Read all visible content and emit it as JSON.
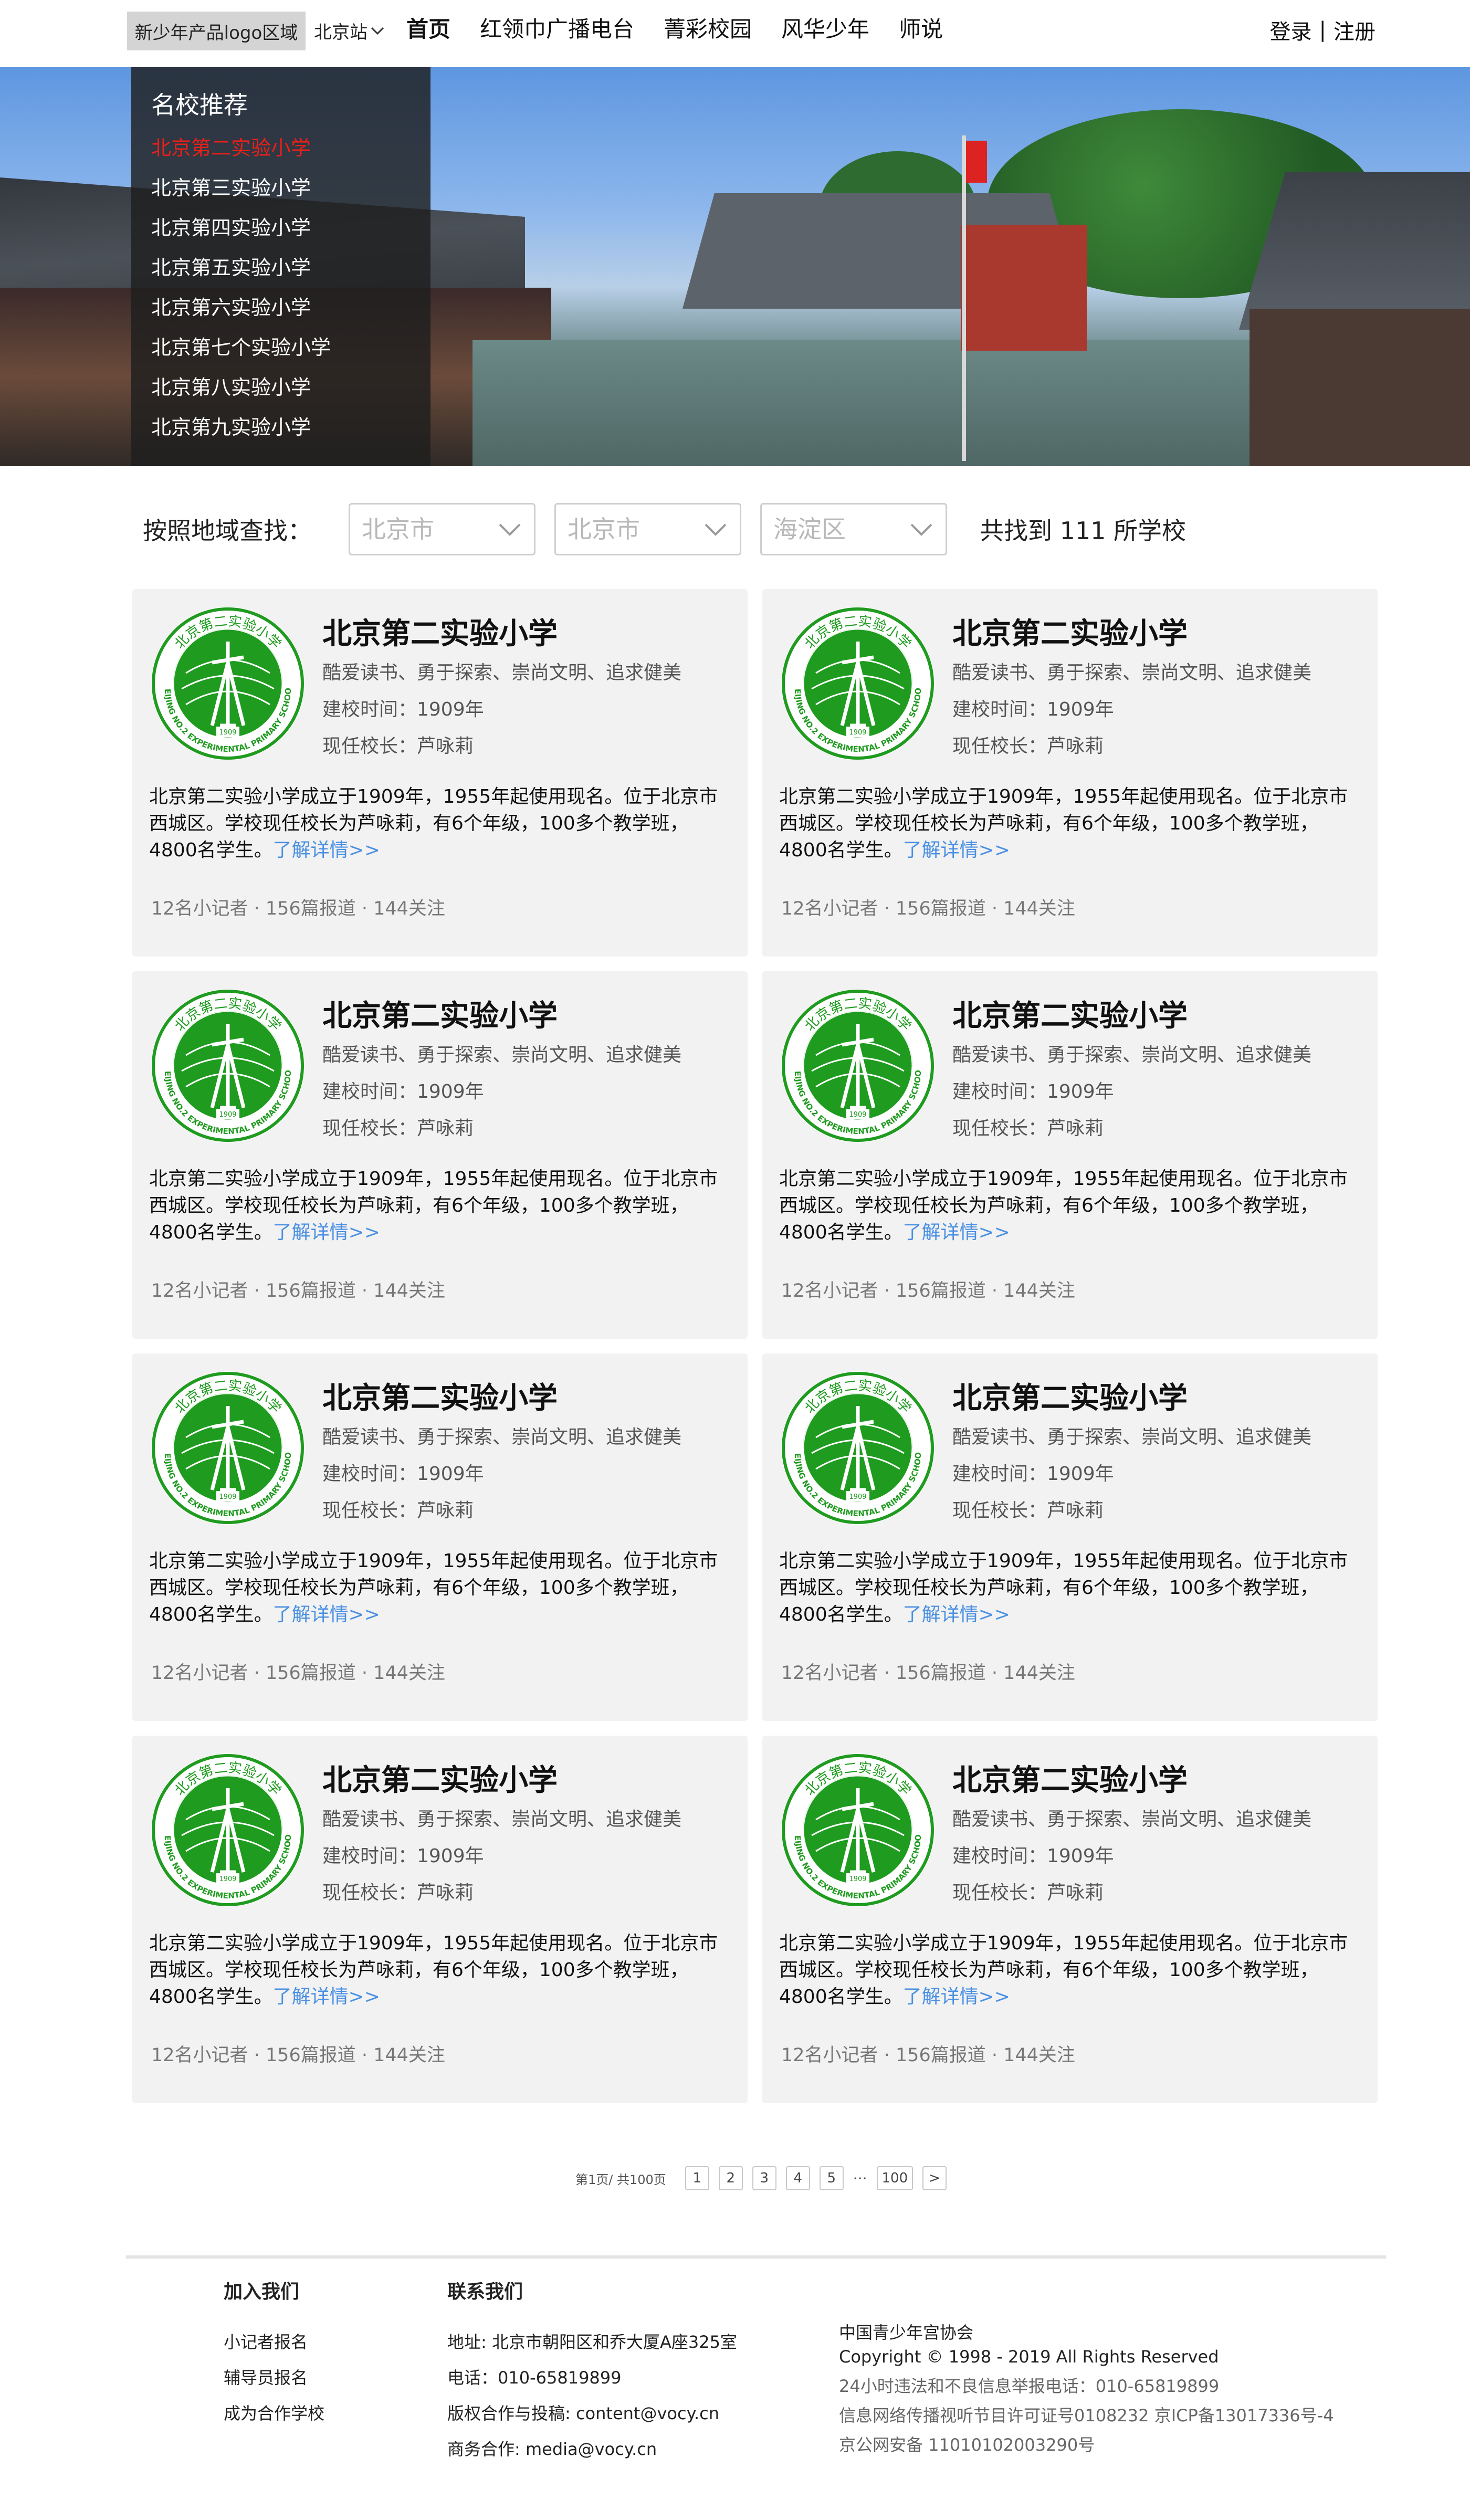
{
  "header": {
    "logo_text": "新少年产品logo区域",
    "station": "北京站",
    "nav": [
      "首页",
      "红领巾广播电台",
      "菁彩校园",
      "风华少年",
      "师说"
    ],
    "login": "登录",
    "separator": "|",
    "register": "注册"
  },
  "hero": {
    "panel_title": "名校推荐",
    "schools": [
      "北京第二实验小学",
      "北京第三实验小学",
      "北京第四实验小学",
      "北京第五实验小学",
      "北京第六实验小学",
      "北京第七个实验小学",
      "北京第八实验小学",
      "北京第九实验小学"
    ]
  },
  "filter": {
    "label": "按照地域查找：",
    "selects": [
      "北京市",
      "北京市",
      "海淀区"
    ],
    "result": "共找到 111 所学校"
  },
  "cards": [
    {
      "title": "北京第二实验小学",
      "motto": "酷爱读书、勇于探索、崇尚文明、追求健美",
      "founded": "建校时间：1909年",
      "principal": "现任校长：芦咏莉",
      "desc": "北京第二实验小学成立于1909年，1955年起使用现名。位于北京市西城区。学校现任校长为芦咏莉，有6个年级，100多个教学班，4800名学生。",
      "more": "了解详情>>",
      "stats": "12名小记者 · 156篇报道 · 144关注"
    },
    {
      "title": "北京第二实验小学",
      "motto": "酷爱读书、勇于探索、崇尚文明、追求健美",
      "founded": "建校时间：1909年",
      "principal": "现任校长：芦咏莉",
      "desc": "北京第二实验小学成立于1909年，1955年起使用现名。位于北京市西城区。学校现任校长为芦咏莉，有6个年级，100多个教学班，4800名学生。",
      "more": "了解详情>>",
      "stats": "12名小记者 · 156篇报道 · 144关注"
    },
    {
      "title": "北京第二实验小学",
      "motto": "酷爱读书、勇于探索、崇尚文明、追求健美",
      "founded": "建校时间：1909年",
      "principal": "现任校长：芦咏莉",
      "desc": "北京第二实验小学成立于1909年，1955年起使用现名。位于北京市西城区。学校现任校长为芦咏莉，有6个年级，100多个教学班，4800名学生。",
      "more": "了解详情>>",
      "stats": "12名小记者 · 156篇报道 · 144关注"
    },
    {
      "title": "北京第二实验小学",
      "motto": "酷爱读书、勇于探索、崇尚文明、追求健美",
      "founded": "建校时间：1909年",
      "principal": "现任校长：芦咏莉",
      "desc": "北京第二实验小学成立于1909年，1955年起使用现名。位于北京市西城区。学校现任校长为芦咏莉，有6个年级，100多个教学班，4800名学生。",
      "more": "了解详情>>",
      "stats": "12名小记者 · 156篇报道 · 144关注"
    },
    {
      "title": "北京第二实验小学",
      "motto": "酷爱读书、勇于探索、崇尚文明、追求健美",
      "founded": "建校时间：1909年",
      "principal": "现任校长：芦咏莉",
      "desc": "北京第二实验小学成立于1909年，1955年起使用现名。位于北京市西城区。学校现任校长为芦咏莉，有6个年级，100多个教学班，4800名学生。",
      "more": "了解详情>>",
      "stats": "12名小记者 · 156篇报道 · 144关注"
    },
    {
      "title": "北京第二实验小学",
      "motto": "酷爱读书、勇于探索、崇尚文明、追求健美",
      "founded": "建校时间：1909年",
      "principal": "现任校长：芦咏莉",
      "desc": "北京第二实验小学成立于1909年，1955年起使用现名。位于北京市西城区。学校现任校长为芦咏莉，有6个年级，100多个教学班，4800名学生。",
      "more": "了解详情>>",
      "stats": "12名小记者 · 156篇报道 · 144关注"
    },
    {
      "title": "北京第二实验小学",
      "motto": "酷爱读书、勇于探索、崇尚文明、追求健美",
      "founded": "建校时间：1909年",
      "principal": "现任校长：芦咏莉",
      "desc": "北京第二实验小学成立于1909年，1955年起使用现名。位于北京市西城区。学校现任校长为芦咏莉，有6个年级，100多个教学班，4800名学生。",
      "more": "了解详情>>",
      "stats": "12名小记者 · 156篇报道 · 144关注"
    },
    {
      "title": "北京第二实验小学",
      "motto": "酷爱读书、勇于探索、崇尚文明、追求健美",
      "founded": "建校时间：1909年",
      "principal": "现任校长：芦咏莉",
      "desc": "北京第二实验小学成立于1909年，1955年起使用现名。位于北京市西城区。学校现任校长为芦咏莉，有6个年级，100多个教学班，4800名学生。",
      "more": "了解详情>>",
      "stats": "12名小记者 · 156篇报道 · 144关注"
    }
  ],
  "seal": {
    "top_text": "北京第二实验小学",
    "ring_text": "BEIJING NO.2 EXPERIMENTAL PRIMARY SCHOOL",
    "year": "1909"
  },
  "pager": {
    "info": "第1页/ 共100页",
    "pages": [
      "1",
      "2",
      "3",
      "4",
      "5"
    ],
    "dots": "···",
    "last": "100",
    "next": ">"
  },
  "footer": {
    "join_title": "加入我们",
    "join_items": [
      "小记者报名",
      "辅导员报名",
      "成为合作学校"
    ],
    "contact_title": "联系我们",
    "contact_items": [
      "地址: 北京市朝阳区和乔大厦A座325室",
      "电话：010-65819899",
      "版权合作与投稿:   content@vocy.cn",
      "商务合作:   media@vocy.cn"
    ],
    "org": "中国青少年宫协会",
    "copyright": "Copyright © 1998 - 2019 All Rights Reserved",
    "report": "24小时违法和不良信息举报电话：010-65819899",
    "license": "信息网络传播视听节目许可证号0108232 京ICP备13017336号-4",
    "police": "京公网安备 11010102003290号"
  },
  "colors": {
    "accent_red": "#e8201a",
    "link_blue": "#4a90e2",
    "card_bg": "#f2f2f2",
    "seal_green": "#1f9b1f"
  }
}
